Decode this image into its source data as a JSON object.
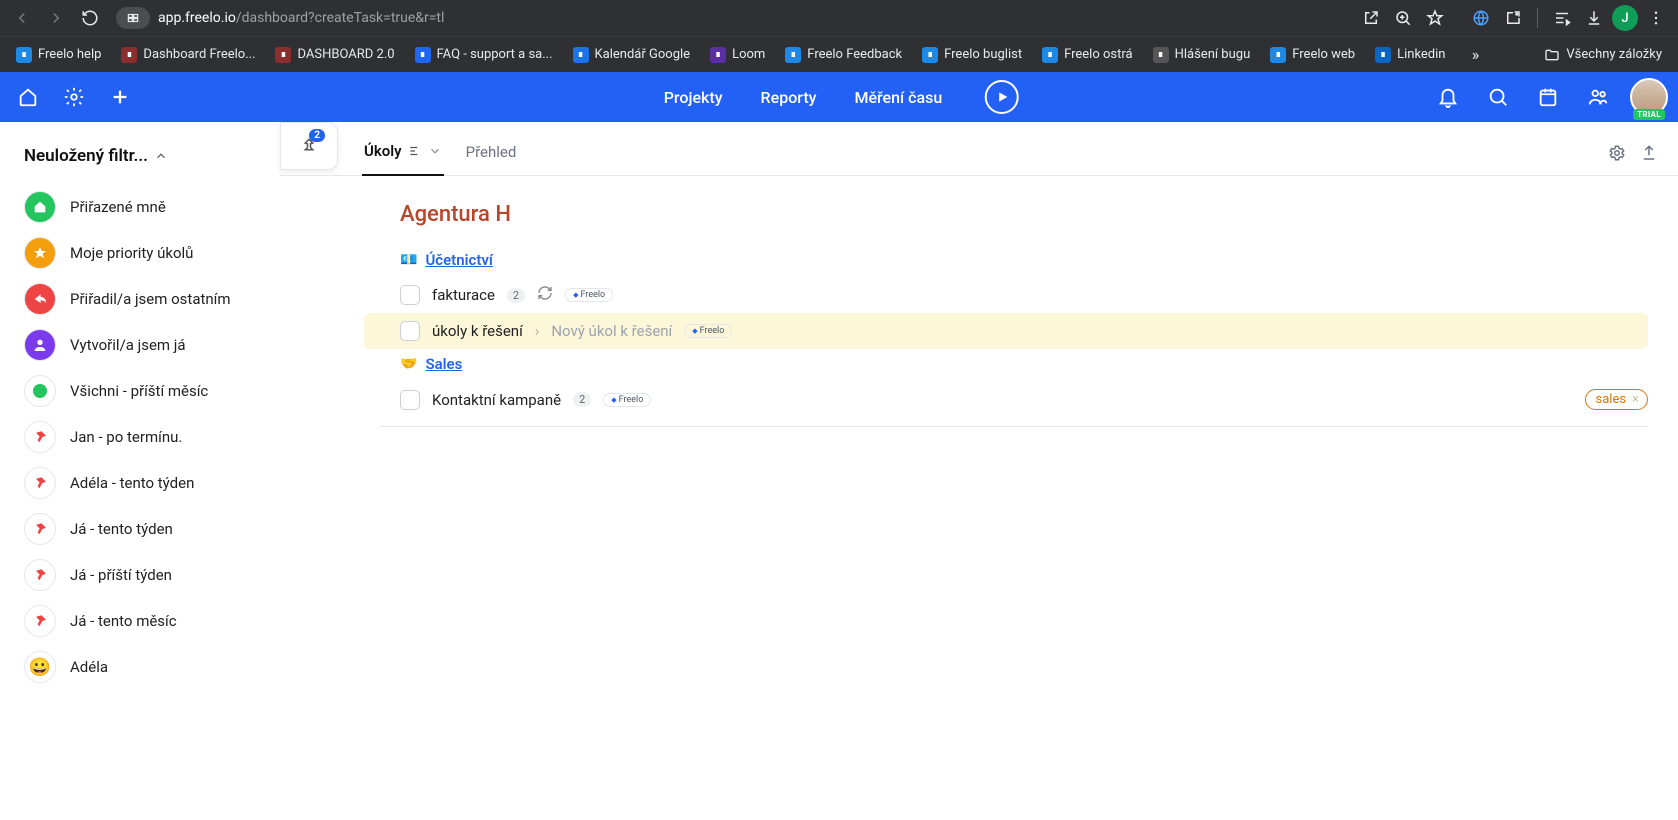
{
  "browser": {
    "url_host": "app.freelo.io",
    "url_path": "/dashboard?createTask=true&r=tl",
    "profile_initial": "J",
    "bookmarks": [
      {
        "label": "Freelo help",
        "color": "#1e88e5"
      },
      {
        "label": "Dashboard Freelo...",
        "color": "#8b2e2e"
      },
      {
        "label": "DASHBOARD 2.0",
        "color": "#8b2e2e"
      },
      {
        "label": "FAQ - support a sa...",
        "color": "#1e66f5"
      },
      {
        "label": "Kalendář Google",
        "color": "#1a73e8"
      },
      {
        "label": "Loom",
        "color": "#5b2ea6"
      },
      {
        "label": "Freelo Feedback",
        "color": "#1e88e5"
      },
      {
        "label": "Freelo buglist",
        "color": "#1e88e5"
      },
      {
        "label": "Freelo ostrá",
        "color": "#1e88e5"
      },
      {
        "label": "Hlášení bugu",
        "color": "#555"
      },
      {
        "label": "Freelo web",
        "color": "#1e88e5"
      },
      {
        "label": "Linkedin",
        "color": "#0a66c2"
      }
    ],
    "all_bookmarks": "Všechny záložky"
  },
  "nav": {
    "projekty": "Projekty",
    "reporty": "Reporty",
    "mereni": "Měření času"
  },
  "avatar_badge": "TRIAL",
  "sidebar": {
    "header": "Neuložený filtr...",
    "items": [
      {
        "label": "Přiřazené mně",
        "bg": "#22c55e",
        "icon": "home"
      },
      {
        "label": "Moje priority úkolů",
        "bg": "#f59e0b",
        "icon": "star"
      },
      {
        "label": "Přiřadil/a jsem ostatním",
        "bg": "#ef4444",
        "icon": "share"
      },
      {
        "label": "Vytvořil/a jsem já",
        "bg": "#7c3aed",
        "icon": "user"
      },
      {
        "label": "Všichni - příští měsíc",
        "bg": "#ffffff",
        "icon": "dot-green"
      },
      {
        "label": "Jan - po termínu.",
        "bg": "#ffffff",
        "icon": "pin"
      },
      {
        "label": "Adéla - tento týden",
        "bg": "#ffffff",
        "icon": "pin"
      },
      {
        "label": "Já - tento týden",
        "bg": "#ffffff",
        "icon": "pin"
      },
      {
        "label": "Já - příští týden",
        "bg": "#ffffff",
        "icon": "pin"
      },
      {
        "label": "Já - tento měsíc",
        "bg": "#ffffff",
        "icon": "pin"
      },
      {
        "label": "Adéla",
        "bg": "#ffffff",
        "icon": "smile"
      }
    ]
  },
  "pin_badge": "2",
  "tabs": {
    "ukoly": "Úkoly",
    "prehled": "Přehled"
  },
  "project": {
    "title": "Agentura H"
  },
  "sections": [
    {
      "emoji": "💶",
      "title": "Účetnictví",
      "tasks": [
        {
          "title": "fakturace",
          "count": "2",
          "refresh": true,
          "chip": "Freelo"
        },
        {
          "title": "úkoly k řešení",
          "sub": "Nový úkol k řešení",
          "chip": "Freelo",
          "highlight": true
        }
      ]
    },
    {
      "emoji": "🤝",
      "title": "Sales",
      "tasks": [
        {
          "title": "Kontaktní kampaně",
          "count": "2",
          "chip": "Freelo",
          "tag": "sales"
        }
      ]
    }
  ]
}
